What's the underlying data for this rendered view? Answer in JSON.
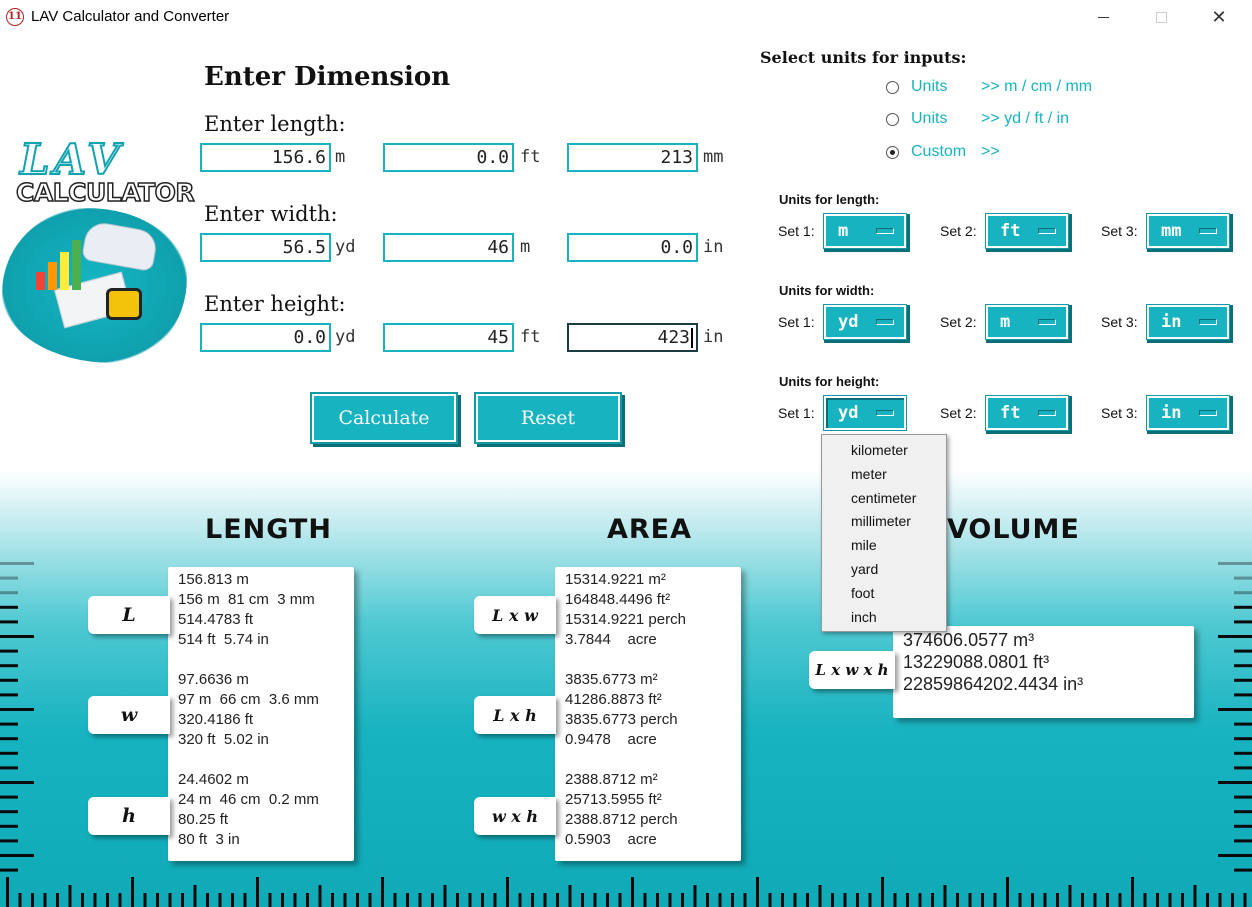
{
  "window": {
    "title": "LAV Calculator and Converter",
    "icon_glyph": "11",
    "min_icon": "minimize-icon",
    "max_icon": "maximize-icon",
    "close_glyph": "✕"
  },
  "logo": {
    "line1": "LAV",
    "line2": "CALCULATOR"
  },
  "dimension": {
    "title": "Enter Dimension",
    "length": {
      "label": "Enter length:",
      "values": [
        "156.6",
        "0.0",
        "213"
      ],
      "units": [
        "m",
        "ft",
        "mm"
      ]
    },
    "width": {
      "label": "Enter width:",
      "values": [
        "56.5",
        "46",
        "0.0"
      ],
      "units": [
        "yd",
        "m",
        "in"
      ]
    },
    "height": {
      "label": "Enter height:",
      "values": [
        "0.0",
        "45",
        "423"
      ],
      "units": [
        "yd",
        "ft",
        "in"
      ]
    }
  },
  "actions": {
    "calculate": "Calculate",
    "reset": "Reset"
  },
  "unit_select": {
    "heading": "Select units for inputs:",
    "options": [
      {
        "label": "Units",
        "desc": ">> m / cm / mm",
        "checked": false
      },
      {
        "label": "Units",
        "desc": ">> yd / ft / in",
        "checked": false
      },
      {
        "label": "Custom",
        "desc": ">>",
        "checked": true
      }
    ],
    "groups": [
      {
        "heading": "Units for length:",
        "sets": [
          {
            "label": "Set 1:",
            "value": "m"
          },
          {
            "label": "Set 2:",
            "value": "ft"
          },
          {
            "label": "Set 3:",
            "value": "mm"
          }
        ]
      },
      {
        "heading": "Units for width:",
        "sets": [
          {
            "label": "Set 1:",
            "value": "yd"
          },
          {
            "label": "Set 2:",
            "value": "m"
          },
          {
            "label": "Set 3:",
            "value": "in"
          }
        ]
      },
      {
        "heading": "Units for height:",
        "sets": [
          {
            "label": "Set 1:",
            "value": "yd"
          },
          {
            "label": "Set 2:",
            "value": "ft"
          },
          {
            "label": "Set 3:",
            "value": "in"
          }
        ]
      }
    ]
  },
  "dropdown": {
    "items": [
      "kilometer",
      "meter",
      "centimeter",
      "millimeter",
      "mile",
      "yard",
      "foot",
      "inch"
    ]
  },
  "results": {
    "length": {
      "heading": "LENGTH",
      "tags": [
        "L",
        "w",
        "h"
      ],
      "groups": [
        [
          "156.813 m",
          "156 m  81 cm  3 mm",
          "514.4783 ft",
          "514 ft  5.74 in"
        ],
        [
          "97.6636 m",
          "97 m  66 cm  3.6 mm",
          "320.4186 ft",
          "320 ft  5.02 in"
        ],
        [
          "24.4602 m",
          "24 m  46 cm  0.2 mm",
          "80.25 ft",
          "80 ft  3 in"
        ]
      ]
    },
    "area": {
      "heading": "AREA",
      "tags": [
        "L x w",
        "L x h",
        "w x h"
      ],
      "groups": [
        [
          "15314.9221 m²",
          "164848.4496 ft²",
          "15314.9221 perch",
          "3.7844    acre"
        ],
        [
          "3835.6773 m²",
          "41286.8873 ft²",
          "3835.6773 perch",
          "0.9478    acre"
        ],
        [
          "2388.8712 m²",
          "25713.5955 ft²",
          "2388.8712 perch",
          "0.5903    acre"
        ]
      ]
    },
    "volume": {
      "heading": "VOLUME",
      "tag": "L x w x h",
      "lines": [
        "374606.0577 m³",
        "13229088.0801 ft³",
        "22859864202.4434 in³"
      ]
    }
  },
  "colors": {
    "accent": "#17b3c0",
    "accent_dark": "#0c6f78"
  }
}
